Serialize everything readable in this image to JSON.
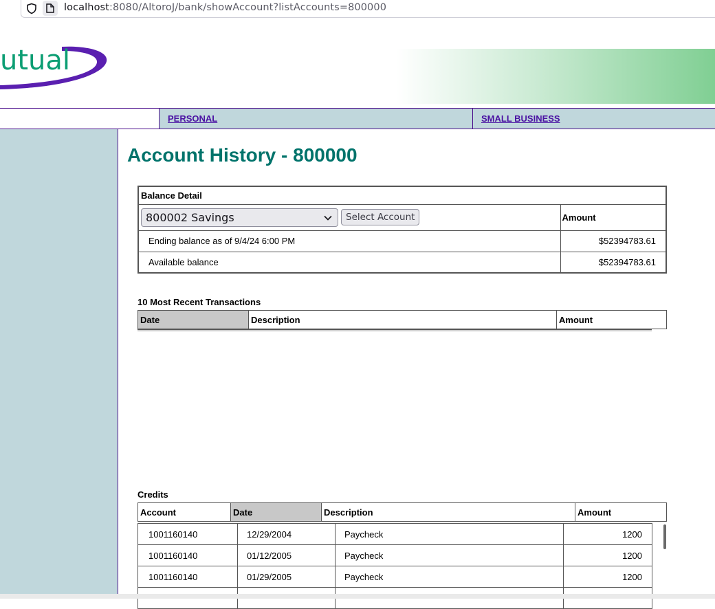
{
  "browser": {
    "url_host": "localhost",
    "url_rest": ":8080/AltoroJ/bank/showAccount?listAccounts=800000"
  },
  "header": {
    "logo_text": "utual"
  },
  "nav": {
    "personal": "PERSONAL",
    "small_business": "SMALL BUSINESS"
  },
  "page": {
    "title": "Account History - 800000"
  },
  "balance": {
    "caption": "Balance Detail",
    "selected_account": "800002 Savings",
    "select_button": "Select Account",
    "amount_header": "Amount",
    "rows": [
      {
        "label": "Ending balance as of 9/4/24 6:00 PM",
        "value": "$52394783.61"
      },
      {
        "label": "Available balance",
        "value": "$52394783.61"
      }
    ]
  },
  "transactions": {
    "title": "10 Most Recent Transactions",
    "headers": [
      "Date",
      "Description",
      "Amount"
    ]
  },
  "credits": {
    "title": "Credits",
    "headers": [
      "Account",
      "Date",
      "Description",
      "Amount"
    ],
    "rows": [
      {
        "account": "1001160140",
        "date": "12/29/2004",
        "description": "Paycheck",
        "amount": "1200"
      },
      {
        "account": "1001160140",
        "date": "01/12/2005",
        "description": "Paycheck",
        "amount": "1200"
      },
      {
        "account": "1001160140",
        "date": "01/29/2005",
        "description": "Paycheck",
        "amount": "1200"
      },
      {
        "account": "",
        "date": "",
        "description": "",
        "amount": ""
      }
    ]
  },
  "colors": {
    "title_teal": "#00736b",
    "nav_bg": "#c0d7dc",
    "nav_link": "#4b13a3",
    "logo_green": "#0c9e73",
    "logo_swoosh": "#5a1fb0"
  }
}
